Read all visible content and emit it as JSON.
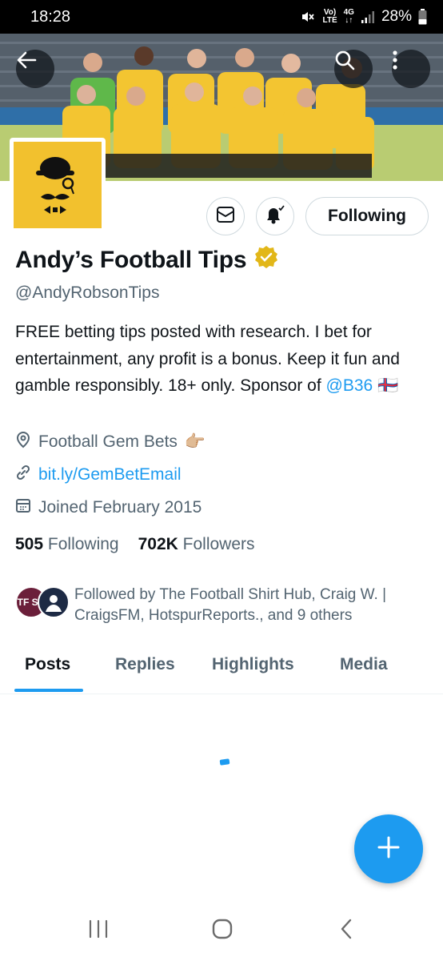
{
  "status_bar": {
    "time": "18:28",
    "volte_top": "Vo)",
    "volte_bottom": "LTE",
    "network": "4G",
    "battery": "28%"
  },
  "profile": {
    "display_name": "Andy’s Football Tips",
    "handle": "@AndyRobsonTips",
    "bio_text": "FREE betting tips posted with research. I bet for entertainment, any profit is a bonus. Keep it fun and gamble responsibly. 18+ only. Sponsor of ",
    "bio_mention": "@B36",
    "bio_flag": "🇫🇴",
    "location": "Football Gem Bets",
    "location_emoji": "👉🏼",
    "link": "bit.ly/GemBetEmail",
    "joined": "Joined February 2015",
    "following_count": "505",
    "following_label": "Following",
    "followers_count": "702K",
    "followers_label": "Followers",
    "followed_by": "Followed by The Football Shirt Hub, Craig W. | CraigsFM, HotspurReports., and 9 others",
    "followed_by_avatar_1": "TF SH"
  },
  "actions": {
    "following_label": "Following"
  },
  "tabs": [
    {
      "label": "Posts",
      "active": true
    },
    {
      "label": "Replies",
      "active": false
    },
    {
      "label": "Highlights",
      "active": false
    },
    {
      "label": "Media",
      "active": false
    }
  ],
  "colors": {
    "accent": "#1d9bf0",
    "avatar_bg": "#f2c12e",
    "verified_badge": "#e2b719",
    "jersey": "#f3c531"
  },
  "icons": {
    "back": "arrow-left-icon",
    "search": "search-icon",
    "more": "more-vertical-icon",
    "message": "envelope-icon",
    "notify": "bell-check-icon",
    "location": "location-pin-icon",
    "link": "link-icon",
    "calendar": "calendar-icon",
    "compose": "plus-icon"
  }
}
